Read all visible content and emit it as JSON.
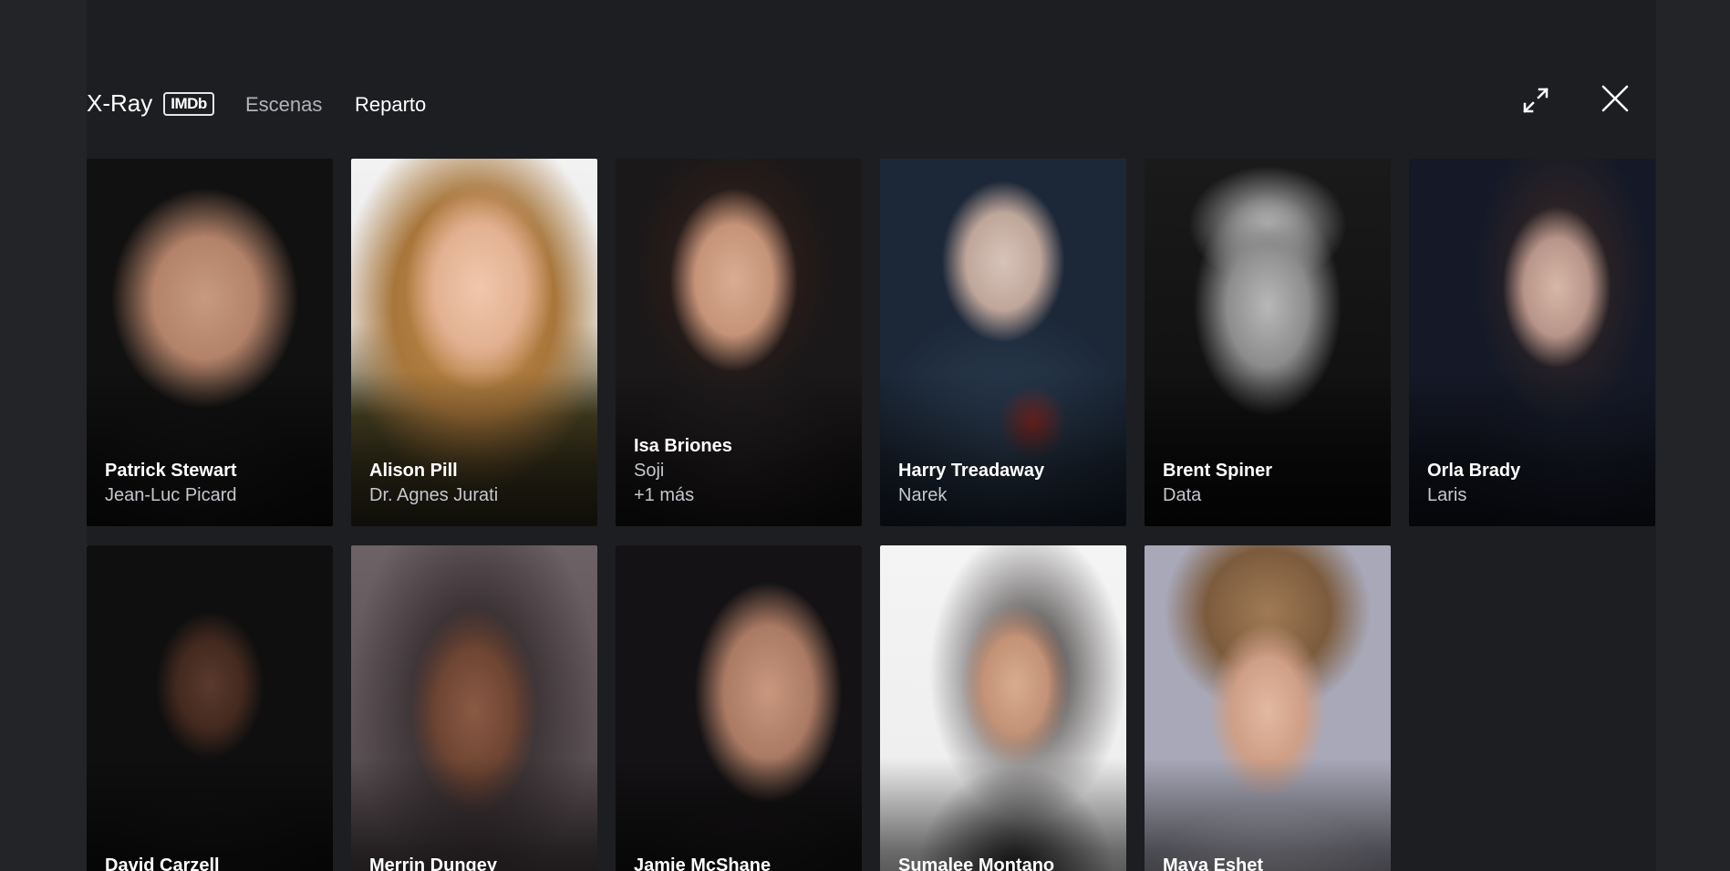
{
  "header": {
    "title": "X-Ray",
    "badge": "IMDb",
    "tabs": [
      {
        "label": "Escenas",
        "active": false
      },
      {
        "label": "Reparto",
        "active": true
      }
    ],
    "expand_icon": "expand-icon",
    "close_icon": "close-icon"
  },
  "colors": {
    "background": "#232427",
    "panel": "#1d1e21",
    "text_primary": "#ffffff",
    "text_secondary": "#c4c7cc",
    "focus_border": "#5f6f7d"
  },
  "cast": [
    {
      "actor": "Patrick Stewart",
      "role": "Jean-Luc Picard",
      "extra": ""
    },
    {
      "actor": "Alison Pill",
      "role": "Dr. Agnes Jurati",
      "extra": ""
    },
    {
      "actor": "Isa Briones",
      "role": "Soji",
      "extra": "+1 más"
    },
    {
      "actor": "Harry Treadaway",
      "role": "Narek",
      "extra": ""
    },
    {
      "actor": "Brent Spiner",
      "role": "Data",
      "extra": ""
    },
    {
      "actor": "Orla Brady",
      "role": "Laris",
      "extra": ""
    },
    {
      "actor": "David Carzell",
      "role": "",
      "extra": ""
    },
    {
      "actor": "Merrin Dungey",
      "role": "",
      "extra": ""
    },
    {
      "actor": "Jamie McShane",
      "role": "",
      "extra": ""
    },
    {
      "actor": "Sumalee Montano",
      "role": "",
      "extra": ""
    },
    {
      "actor": "Maya Eshet",
      "role": "",
      "extra": ""
    }
  ]
}
